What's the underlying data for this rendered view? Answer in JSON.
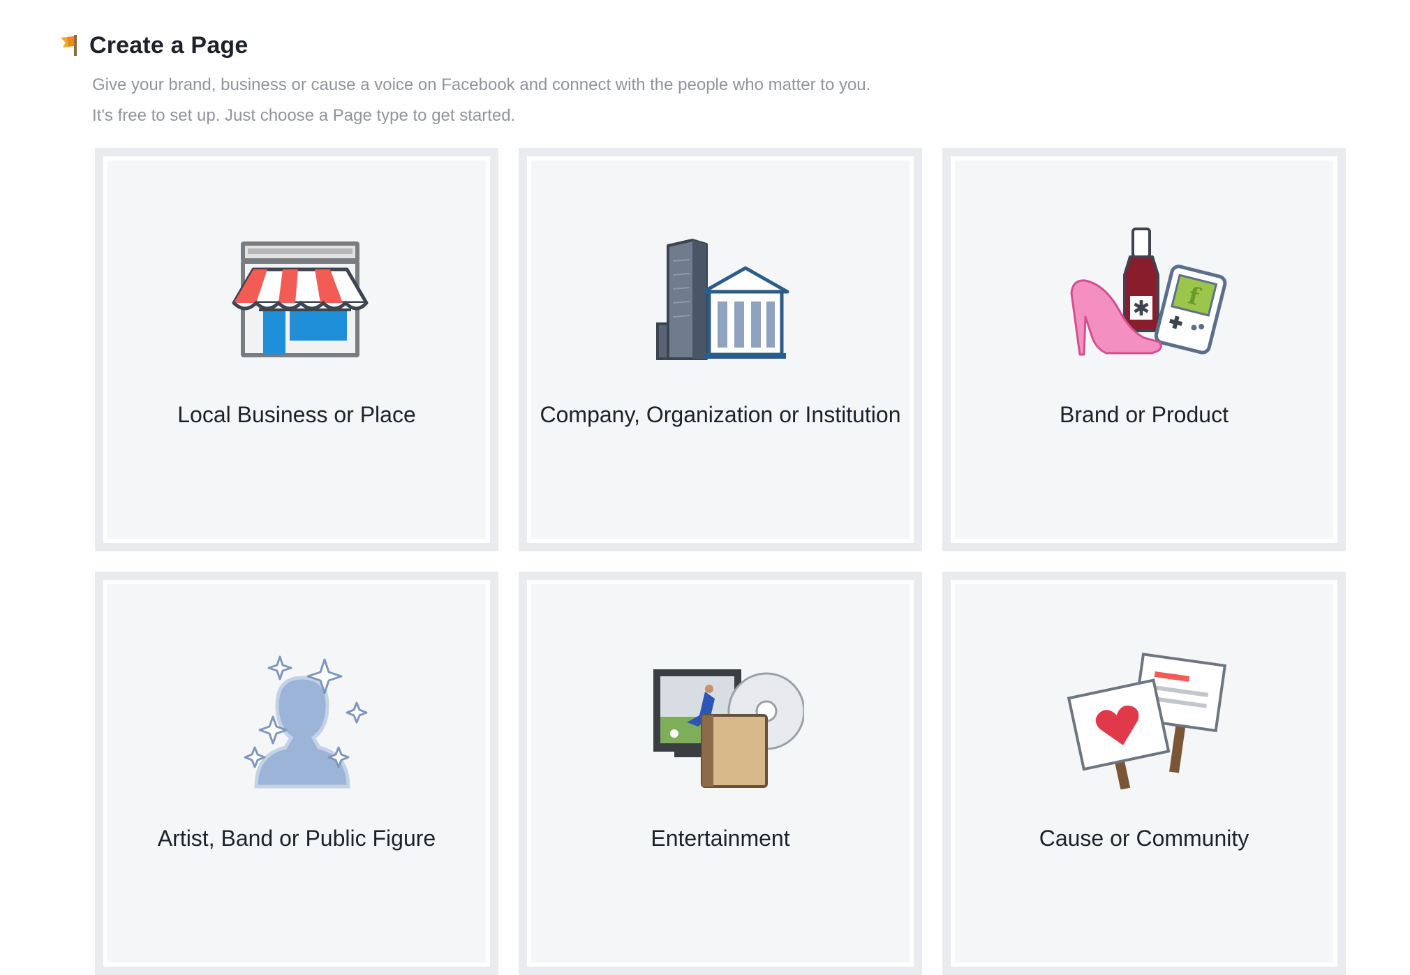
{
  "header": {
    "title": "Create a Page",
    "icon": "flag-icon",
    "subtitle_line1": "Give your brand, business or cause a voice on Facebook and connect with the people who matter to you.",
    "subtitle_line2": "It's free to set up. Just choose a Page type to get started."
  },
  "cards": [
    {
      "label": "Local Business or Place",
      "icon": "storefront-icon"
    },
    {
      "label": "Company, Organization or Institution",
      "icon": "buildings-icon"
    },
    {
      "label": "Brand or Product",
      "icon": "products-icon"
    },
    {
      "label": "Artist, Band or Public Figure",
      "icon": "public-figure-icon"
    },
    {
      "label": "Entertainment",
      "icon": "entertainment-icon"
    },
    {
      "label": "Cause or Community",
      "icon": "protest-signs-icon"
    }
  ],
  "colors": {
    "title": "#1d2129",
    "subtitle": "#90949c",
    "card_bg": "#f5f6f7",
    "card_border": "#e9ebee",
    "awning_red": "#f25c54",
    "store_blue": "#1e8fd8",
    "silhouette": "#9cb4d8",
    "heel_pink": "#f48fc1"
  }
}
